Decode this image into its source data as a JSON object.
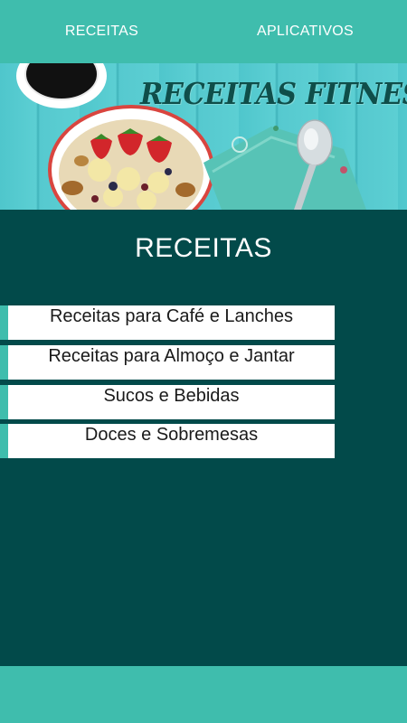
{
  "tabs": {
    "recipes": "RECEITAS",
    "apps": "APLICATIVOS"
  },
  "banner": {
    "title": "RECEITAS FITNESS"
  },
  "section": {
    "title": "RECEITAS"
  },
  "menu": {
    "items": [
      {
        "label": "Receitas para Café e Lanches"
      },
      {
        "label": "Receitas para Almoço e Jantar"
      },
      {
        "label": "Sucos e Bebidas"
      },
      {
        "label": "Doces e Sobremesas"
      }
    ]
  },
  "colors": {
    "accent": "#3fbdad",
    "background": "#024a4a",
    "banner_title": "#0f4e4a"
  }
}
